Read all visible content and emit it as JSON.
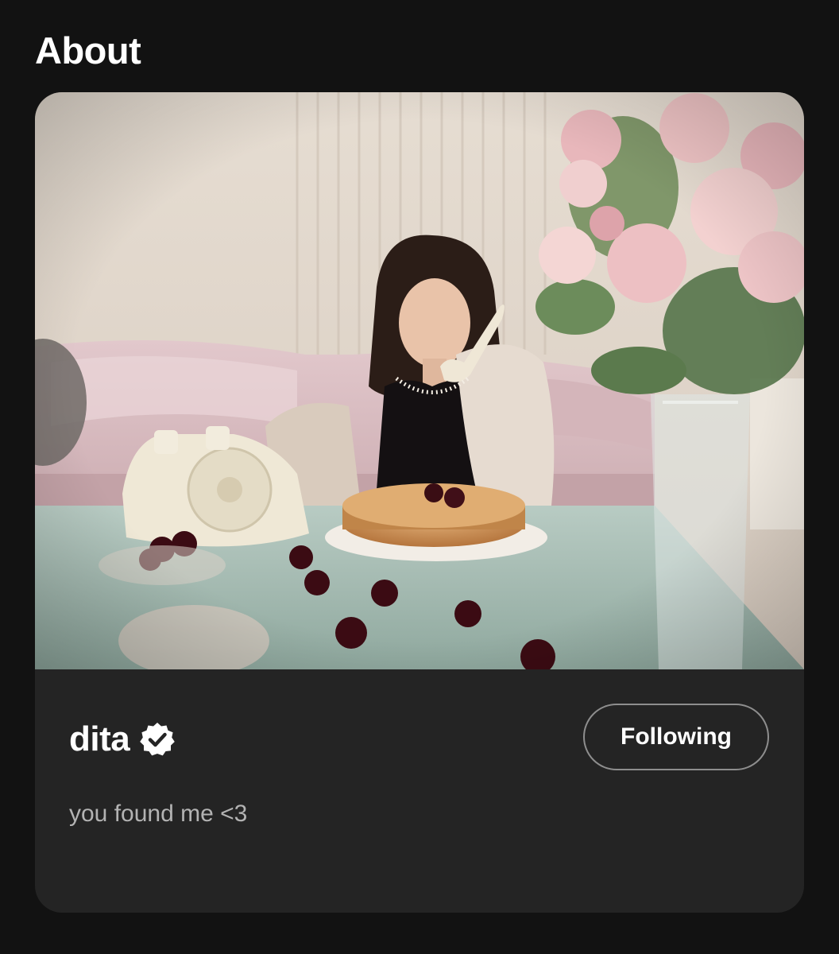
{
  "section": {
    "title": "About"
  },
  "artist": {
    "name": "dita",
    "verified": true,
    "bio": "you found me <3",
    "follow_label": "Following"
  },
  "colors": {
    "background": "#121212",
    "card": "#242424",
    "text_primary": "#ffffff",
    "text_secondary": "#b3b3b3",
    "button_border": "#8e8e8e"
  },
  "icons": {
    "verified": "verified-badge-icon"
  }
}
